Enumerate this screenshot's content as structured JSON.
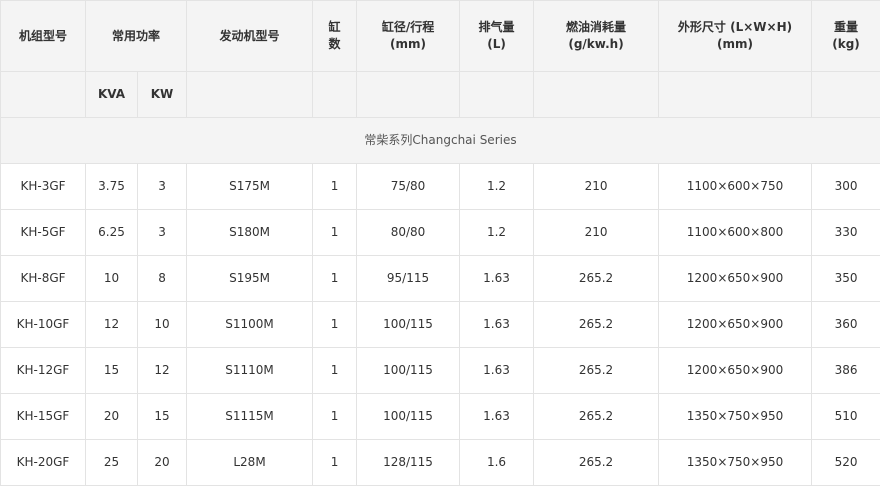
{
  "headers": {
    "model": "机组型号",
    "power": "常用功率",
    "engine": "发动机型号",
    "cyl_1": "缸",
    "cyl_2": "数",
    "bore_1": "缸径/行程",
    "bore_2": "(mm)",
    "disp_1": "排气量",
    "disp_2": "(L)",
    "fuel_1": "燃油消耗量",
    "fuel_2": "(g/kw.h)",
    "dim_1": "外形尺寸 (L×W×H)",
    "dim_2": "(mm)",
    "weight_1": "重量",
    "weight_2": "(kg)"
  },
  "subheaders": {
    "kva": "KVA",
    "kw": "KW"
  },
  "series_label": "常柴系列Changchai Series",
  "rows": [
    {
      "model": "KH-3GF",
      "kva": "3.75",
      "kw": "3",
      "engine": "S175M",
      "cyl": "1",
      "bore": "75/80",
      "disp": "1.2",
      "fuel": "210",
      "dim": "1100×600×750",
      "weight": "300"
    },
    {
      "model": "KH-5GF",
      "kva": "6.25",
      "kw": "3",
      "engine": "S180M",
      "cyl": "1",
      "bore": "80/80",
      "disp": "1.2",
      "fuel": "210",
      "dim": "1100×600×800",
      "weight": "330"
    },
    {
      "model": "KH-8GF",
      "kva": "10",
      "kw": "8",
      "engine": "S195M",
      "cyl": "1",
      "bore": "95/115",
      "disp": "1.63",
      "fuel": "265.2",
      "dim": "1200×650×900",
      "weight": "350"
    },
    {
      "model": "KH-10GF",
      "kva": "12",
      "kw": "10",
      "engine": "S1100M",
      "cyl": "1",
      "bore": "100/115",
      "disp": "1.63",
      "fuel": "265.2",
      "dim": "1200×650×900",
      "weight": "360"
    },
    {
      "model": "KH-12GF",
      "kva": "15",
      "kw": "12",
      "engine": "S1110M",
      "cyl": "1",
      "bore": "100/115",
      "disp": "1.63",
      "fuel": "265.2",
      "dim": "1200×650×900",
      "weight": "386"
    },
    {
      "model": "KH-15GF",
      "kva": "20",
      "kw": "15",
      "engine": "S1115M",
      "cyl": "1",
      "bore": "100/115",
      "disp": "1.63",
      "fuel": "265.2",
      "dim": "1350×750×950",
      "weight": "510"
    },
    {
      "model": "KH-20GF",
      "kva": "25",
      "kw": "20",
      "engine": "L28M",
      "cyl": "1",
      "bore": "128/115",
      "disp": "1.6",
      "fuel": "265.2",
      "dim": "1350×750×950",
      "weight": "520"
    }
  ]
}
